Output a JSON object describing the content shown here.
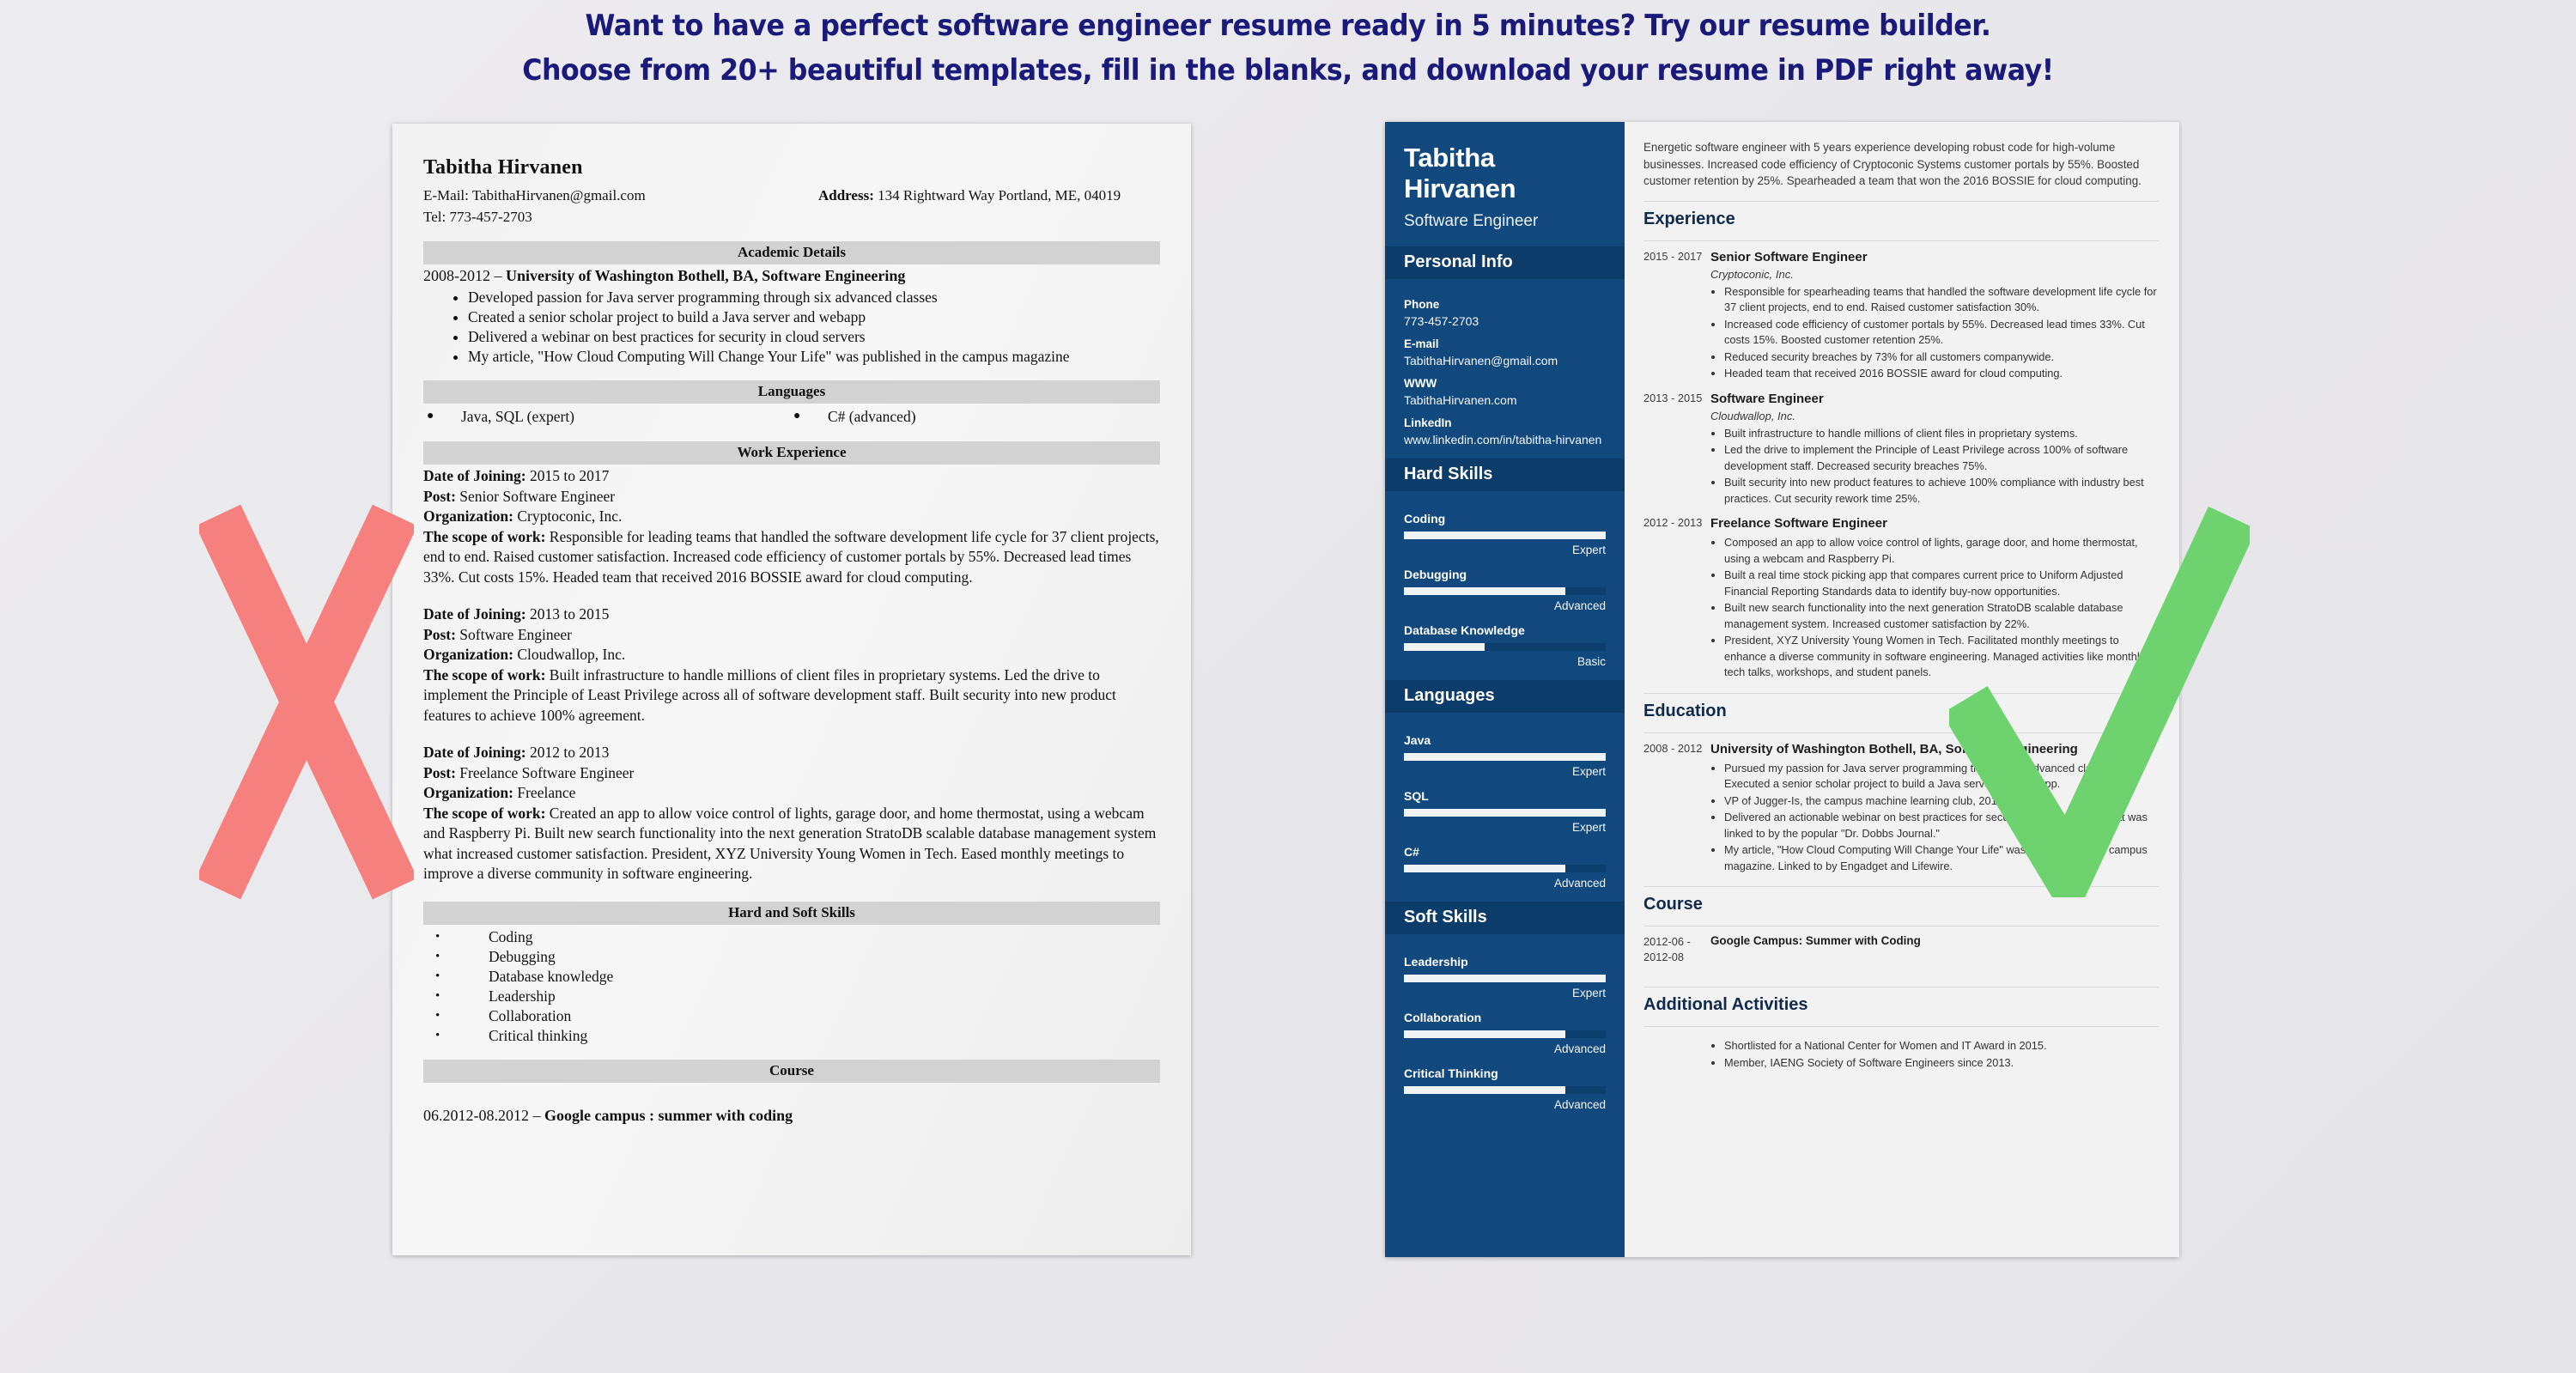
{
  "promo": {
    "line1": "Want to have a perfect software engineer resume ready in 5 minutes? Try our resume builder.",
    "line2": "Choose from 20+ beautiful templates, fill in the blanks, and download your resume in PDF right away!",
    "color": "#1a1a7a"
  },
  "marks": {
    "x_color": "#f5807d",
    "check_color": "#6ed36e",
    "x_name": "rejected-x-mark",
    "check_name": "approved-check-mark"
  },
  "bad_resume": {
    "name": "Tabitha Hirvanen",
    "email_line": "E-Mail: TabithaHirvanen@gmail.com",
    "tel_line": "Tel: 773-457-2703",
    "address_label": "Address:",
    "address_value": "134 Rightward Way Portland, ME, 04019",
    "academic_heading": "Academic Details",
    "academic_degree_years": "2008-2012 – ",
    "academic_degree": "University of Washington Bothell, BA, Software Engineering",
    "academic_bullets": [
      "Developed passion for Java server programming through six advanced classes",
      "Created a senior scholar project to build a Java server and webapp",
      "Delivered a webinar on best practices for security in cloud servers",
      "My article, \"How Cloud Computing Will Change Your Life\" was published in the campus magazine"
    ],
    "languages_heading": "Languages",
    "languages": [
      "Java, SQL (expert)",
      "C# (advanced)"
    ],
    "work_heading": "Work Experience",
    "jobs": [
      {
        "date_label": "Date of Joining:",
        "date_value": " 2015 to 2017",
        "post_label": "Post:",
        "post_value": " Senior Software Engineer",
        "org_label": "Organization:",
        "org_value": " Cryptoconic, Inc.",
        "scope_label": "The scope of work:",
        "scope_value": " Responsible for leading teams that handled the software development life cycle for 37 client projects, end to end. Raised customer satisfaction. Increased code efficiency of customer portals by 55%. Decreased lead times 33%. Cut costs 15%. Headed team that received 2016 BOSSIE award for cloud computing."
      },
      {
        "date_label": "Date of Joining:",
        "date_value": " 2013 to 2015",
        "post_label": "Post:",
        "post_value": " Software Engineer",
        "org_label": "Organization:",
        "org_value": " Cloudwallop, Inc.",
        "scope_label": "The scope of work:",
        "scope_value": " Built infrastructure to handle millions of client files in proprietary systems. Led the drive to implement the Principle of Least Privilege across all of software development staff. Built security into new product features to achieve 100% agreement."
      },
      {
        "date_label": "Date of Joining:",
        "date_value": " 2012 to 2013",
        "post_label": "Post:",
        "post_value": " Freelance Software Engineer",
        "org_label": "Organization:",
        "org_value": " Freelance",
        "scope_label": "The scope of work:",
        "scope_value": " Created an app to allow voice control of lights, garage door, and home thermostat, using a webcam and Raspberry Pi. Built new search functionality into the next generation StratoDB scalable database management system what increased customer satisfaction. President, XYZ University Young Women in Tech. Eased monthly meetings to improve a diverse community in software engineering."
      }
    ],
    "skills_heading": "Hard and Soft Skills",
    "skills": [
      "Coding",
      "Debugging",
      "Database knowledge",
      "Leadership",
      "Collaboration",
      "Critical thinking"
    ],
    "course_heading": "Course",
    "course_dates": "06.2012-08.2012 – ",
    "course_name": "Google campus : summer with coding"
  },
  "good_resume": {
    "sidebar": {
      "name": "Tabitha Hirvanen",
      "role": "Software Engineer",
      "personal_info_heading": "Personal Info",
      "contacts": [
        {
          "label": "Phone",
          "value": "773-457-2703"
        },
        {
          "label": "E-mail",
          "value": "TabithaHirvanen@gmail.com"
        },
        {
          "label": "WWW",
          "value": "TabithaHirvanen.com"
        },
        {
          "label": "LinkedIn",
          "value": "www.linkedin.com/in/tabitha-hirvanen"
        }
      ],
      "hard_skills_heading": "Hard Skills",
      "hard_skills": [
        {
          "name": "Coding",
          "level": "Expert",
          "percent": 100
        },
        {
          "name": "Debugging",
          "level": "Advanced",
          "percent": 80
        },
        {
          "name": "Database Knowledge",
          "level": "Basic",
          "percent": 40
        }
      ],
      "languages_heading": "Languages",
      "languages": [
        {
          "name": "Java",
          "level": "Expert",
          "percent": 100
        },
        {
          "name": "SQL",
          "level": "Expert",
          "percent": 100
        },
        {
          "name": "C#",
          "level": "Advanced",
          "percent": 80
        }
      ],
      "soft_skills_heading": "Soft Skills",
      "soft_skills": [
        {
          "name": "Leadership",
          "level": "Expert",
          "percent": 100
        },
        {
          "name": "Collaboration",
          "level": "Advanced",
          "percent": 80
        },
        {
          "name": "Critical Thinking",
          "level": "Advanced",
          "percent": 80
        }
      ],
      "bg_color": "#11497f",
      "section_bg_color": "#0c3c69"
    },
    "main": {
      "summary": "Energetic software engineer with 5 years experience developing robust code for high-volume businesses. Increased code efficiency of Cryptoconic Systems customer portals by 55%. Boosted customer retention by 25%. Spearheaded a team that won the 2016 BOSSIE for cloud computing.",
      "experience_heading": "Experience",
      "experience": [
        {
          "dates": "2015 - 2017",
          "title": "Senior Software Engineer",
          "org": "Cryptoconic, Inc.",
          "bullets": [
            "Responsible for spearheading teams that handled the software development life cycle for 37 client projects, end to end. Raised customer satisfaction 30%.",
            "Increased code efficiency of customer portals by 55%. Decreased lead times 33%. Cut costs 15%. Boosted customer retention 25%.",
            "Reduced security breaches by 73% for all customers companywide.",
            "Headed team that received 2016 BOSSIE award for cloud computing."
          ]
        },
        {
          "dates": "2013 - 2015",
          "title": "Software Engineer",
          "org": "Cloudwallop, Inc.",
          "bullets": [
            "Built infrastructure to handle millions of client files in proprietary systems.",
            "Led the drive to implement the Principle of Least Privilege across 100% of software development staff. Decreased security breaches 75%.",
            "Built security into new product features to achieve 100% compliance with industry best practices. Cut security rework time 25%."
          ]
        },
        {
          "dates": "2012 - 2013",
          "title": "Freelance Software Engineer",
          "org": "",
          "bullets": [
            "Composed an app to allow voice control of lights, garage door, and home thermostat, using a webcam and Raspberry Pi.",
            "Built a real time stock picking app that compares current price to Uniform Adjusted Financial Reporting Standards data to identify buy-now opportunities.",
            "Built new search functionality into the next generation StratoDB scalable database management system. Increased customer satisfaction by 22%.",
            "President, XYZ University Young Women in Tech. Facilitated monthly meetings to enhance a diverse community in software engineering. Managed activities like monthly tech talks, workshops, and student panels."
          ]
        }
      ],
      "education_heading": "Education",
      "education": [
        {
          "dates": "2008 - 2012",
          "title": "University of Washington Bothell, BA, Software Engineering",
          "bullets": [
            "Pursued my passion for Java server programming through six advanced classes. Executed a senior scholar project to build a Java server and webapp.",
            "VP of Jugger-Is, the campus machine learning club, 2014-2015.",
            "Delivered an actionable webinar on best practices for security in cloud servers that was linked to by the popular \"Dr. Dobbs Journal.\"",
            "My article, \"How Cloud Computing Will Change Your Life\" was published in the campus magazine. Linked to by Engadget and Lifewire."
          ]
        }
      ],
      "course_heading": "Course",
      "course": {
        "dates": "2012-06 - 2012-08",
        "title": "Google Campus: Summer with Coding"
      },
      "activities_heading": "Additional Activities",
      "activities": [
        "Shortlisted for a National Center for Women and IT Award in 2015.",
        "Member, IAENG Society of Software Engineers since 2013."
      ],
      "heading_color": "#102a4c"
    }
  }
}
